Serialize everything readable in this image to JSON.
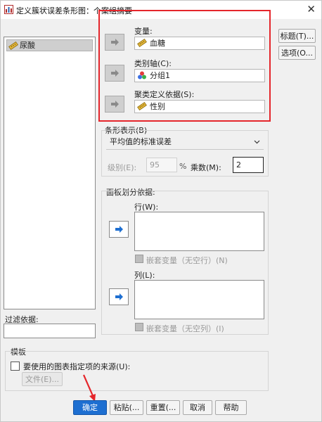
{
  "window": {
    "title": "定义簇状误差条形图：个案组摘要",
    "close_glyph": "✕"
  },
  "source_list": {
    "items": [
      {
        "label": "尿酸",
        "icon": "scale-ruler-icon"
      }
    ]
  },
  "variable": {
    "label": "变量:",
    "value": "血糖",
    "icon": "scale-ruler-icon"
  },
  "category_axis": {
    "label": "类别轴(C):",
    "value": "分组1",
    "icon": "nominal-variable-icon"
  },
  "cluster_define": {
    "label": "聚类定义依据(S):",
    "value": "性别",
    "icon": "scale-ruler-icon"
  },
  "side_buttons": {
    "titles": "标题(T)...",
    "options": "选项(O..."
  },
  "bar_display": {
    "label": "条形表示(B)",
    "selected": "平均值的标准误差",
    "level_label": "级别(E):",
    "level_value": "95",
    "percent": "%",
    "multiplier_label": "乘数(M):",
    "multiplier_value": "2"
  },
  "panel": {
    "label": "面板划分依据:",
    "row_label": "行(W):",
    "row_nest": "嵌套变量（无空行）(N)",
    "col_label": "列(L):",
    "col_nest": "嵌套变量（无空列）(I)"
  },
  "filter": {
    "label": "过滤依据:"
  },
  "template": {
    "label": "模板",
    "checkbox_label": "要使用的图表指定项的来源(U):",
    "file_button": "文件(E)..."
  },
  "bottom_buttons": {
    "ok": "确定",
    "paste": "粘贴(...",
    "reset": "重置(...",
    "cancel": "取消",
    "help": "帮助"
  },
  "colors": {
    "highlight_box": "#e5262b",
    "ok_button": "#1e6fd1"
  }
}
